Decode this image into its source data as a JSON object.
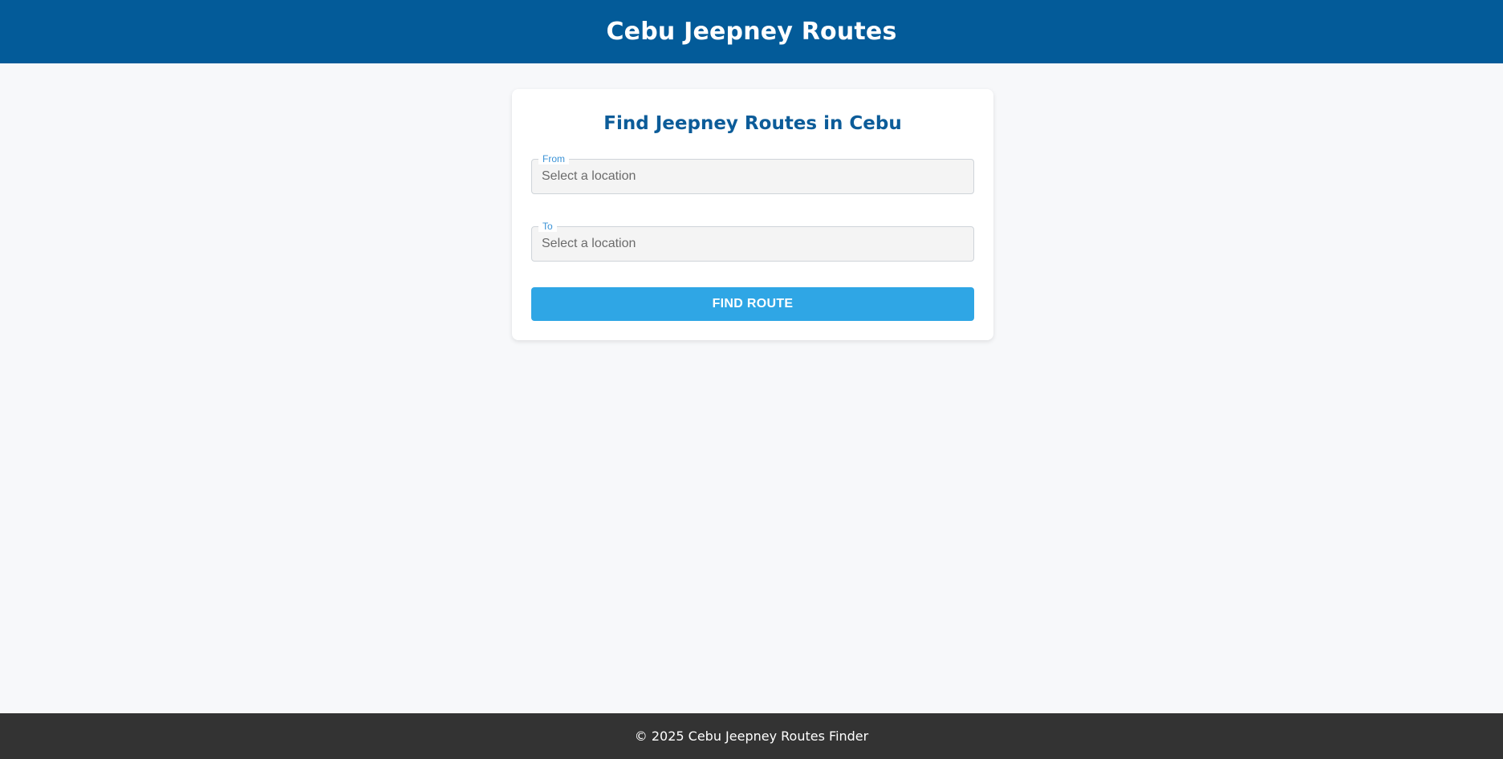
{
  "header": {
    "title": "Cebu Jeepney Routes"
  },
  "search_card": {
    "title": "Find Jeepney Routes in Cebu",
    "from_field": {
      "label": "From",
      "placeholder": "Select a location",
      "value": ""
    },
    "to_field": {
      "label": "To",
      "placeholder": "Select a location",
      "value": ""
    },
    "submit_label": "FIND ROUTE"
  },
  "footer": {
    "text": "© 2025 Cebu Jeepney Routes Finder"
  },
  "colors": {
    "header_bg": "#035b99",
    "accent": "#2fa6e5",
    "title_color": "#0c5c99",
    "footer_bg": "#333333"
  }
}
